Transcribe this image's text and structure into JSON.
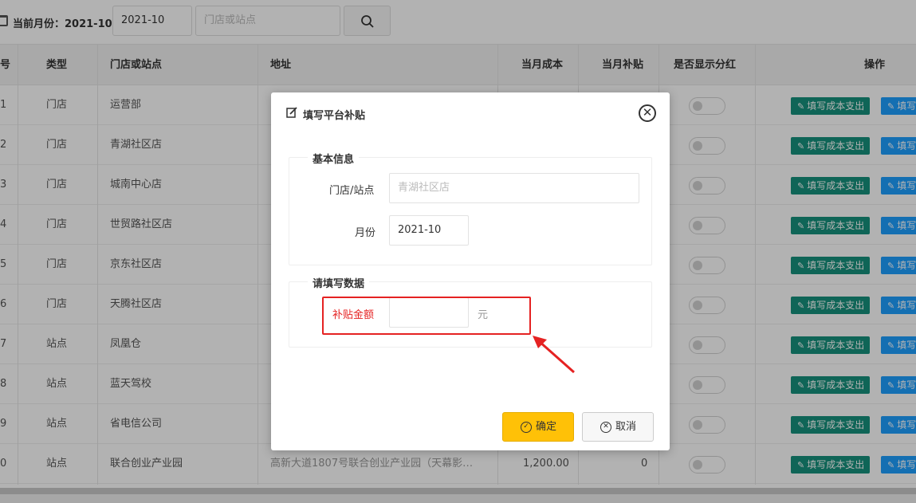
{
  "filter": {
    "month_label": "当前月份：2021-10",
    "month_value": "2021-10",
    "store_placeholder": "门店或站点"
  },
  "table": {
    "headers": [
      "号",
      "类型",
      "门店或站点",
      "地址",
      "当月成本",
      "当月补贴",
      "是否显示分红",
      "操作"
    ],
    "rows": [
      {
        "no": "1",
        "type": "门店",
        "name": "运营部",
        "address": "",
        "cost": "",
        "subsidy": ""
      },
      {
        "no": "2",
        "type": "门店",
        "name": "青湖社区店",
        "address": "",
        "cost": "",
        "subsidy": ""
      },
      {
        "no": "3",
        "type": "门店",
        "name": "城南中心店",
        "address": "",
        "cost": "",
        "subsidy": ""
      },
      {
        "no": "4",
        "type": "门店",
        "name": "世贸路社区店",
        "address": "",
        "cost": "",
        "subsidy": ""
      },
      {
        "no": "5",
        "type": "门店",
        "name": "京东社区店",
        "address": "",
        "cost": "",
        "subsidy": ""
      },
      {
        "no": "6",
        "type": "门店",
        "name": "天腾社区店",
        "address": "",
        "cost": "",
        "subsidy": ""
      },
      {
        "no": "7",
        "type": "站点",
        "name": "凤凰仓",
        "address": "",
        "cost": "",
        "subsidy": ""
      },
      {
        "no": "8",
        "type": "站点",
        "name": "蓝天驾校",
        "address": "",
        "cost": "",
        "subsidy": ""
      },
      {
        "no": "9",
        "type": "站点",
        "name": "省电信公司",
        "address": "",
        "cost": "",
        "subsidy": ""
      },
      {
        "no": "0",
        "type": "站点",
        "name": "联合创业产业园",
        "address": "高新大道1807号联合创业产业园（天幕影…",
        "cost": "1,200.00",
        "subsidy": "0"
      }
    ],
    "action_cost_label": "填写成本支出",
    "action_subsidy_label": "填写"
  },
  "dialog": {
    "title": "填写平台补贴",
    "section_basic": "基本信息",
    "store_label": "门店/站点",
    "store_value": "青湖社区店",
    "month_label": "月份",
    "month_value": "2021-10",
    "section_data": "请填写数据",
    "amount_label": "补贴金额",
    "amount_value": "",
    "amount_unit": "元",
    "confirm_label": "确定",
    "cancel_label": "取消"
  },
  "colors": {
    "accent": "#ffc107",
    "teal": "#16917d",
    "blue": "#1e9fff",
    "highlight": "#e52222"
  }
}
